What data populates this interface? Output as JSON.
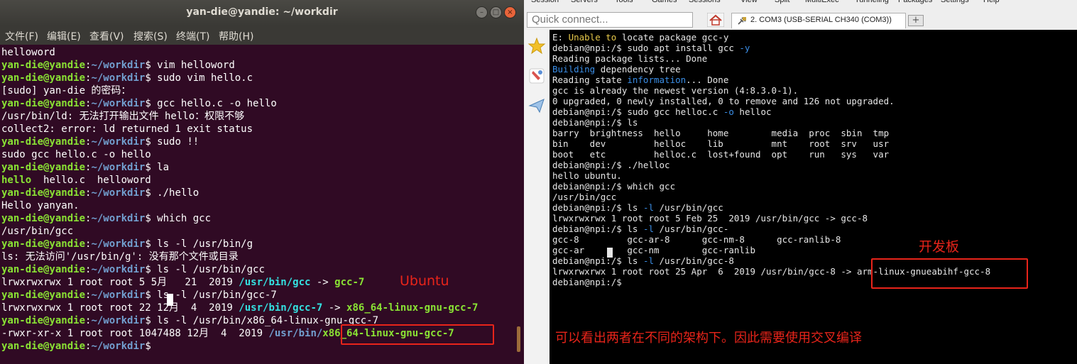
{
  "ubuntu": {
    "title": "yan-die@yandie: ~/workdir",
    "menu": [
      "文件(F)",
      "编辑(E)",
      "查看(V)",
      "搜索(S)",
      "终端(T)",
      "帮助(H)"
    ],
    "prompt_user": "yan-die@yandie",
    "prompt_path": "~/workdir",
    "lines": [
      {
        "t": "out",
        "text": "helloword"
      },
      {
        "t": "cmd",
        "text": "vim helloword"
      },
      {
        "t": "cmd",
        "text": "sudo vim hello.c"
      },
      {
        "t": "out",
        "text": "[sudo] yan-die 的密码："
      },
      {
        "t": "cmd",
        "text": "gcc hello.c -o hello"
      },
      {
        "t": "out",
        "text": "/usr/bin/ld: 无法打开输出文件 hello：权限不够"
      },
      {
        "t": "out",
        "text": "collect2: error: ld returned 1 exit status"
      },
      {
        "t": "cmd",
        "text": "sudo !!"
      },
      {
        "t": "out",
        "text": "sudo gcc hello.c -o hello"
      },
      {
        "t": "cmd",
        "text": "la"
      },
      {
        "t": "ls",
        "exe": "hello",
        "rest": "  hello.c  helloword"
      },
      {
        "t": "cmd",
        "text": "./hello"
      },
      {
        "t": "out",
        "text": "Hello yanyan."
      },
      {
        "t": "cmd",
        "text": "which gcc"
      },
      {
        "t": "out",
        "text": "/usr/bin/gcc"
      },
      {
        "t": "cmd",
        "text": "ls -l /usr/bin/g"
      },
      {
        "t": "out",
        "text": "ls: 无法访问'/usr/bin/g': 没有那个文件或目录"
      },
      {
        "t": "cmd",
        "text": "ls -l /usr/bin/gcc"
      },
      {
        "t": "link",
        "pre": "lrwxrwxrwx 1 root root 5 5月   21  2019 ",
        "link": "/usr/bin/gcc",
        "arrow": " -> ",
        "target": "gcc-7"
      },
      {
        "t": "cmd",
        "text": "ls -l /usr/bin/gcc-7"
      },
      {
        "t": "link",
        "pre": "lrwxrwxrwx 1 root root 22 12月  4  2019 ",
        "link": "/usr/bin/gcc-7",
        "arrow": " -> ",
        "target": "x86_64-linux-gnu-gcc-7"
      },
      {
        "t": "cmd",
        "text": "ls -l /usr/bin/x86_64-linux-gnu-gcc-7"
      },
      {
        "t": "exe",
        "pre": "-rwxr-xr-x 1 root root 1047488 12月  4  2019 ",
        "path": "/usr/bin/",
        "file": "x86_64-linux-gnu-gcc-7"
      },
      {
        "t": "cmd",
        "text": ""
      }
    ],
    "annotation": "Ubuntu"
  },
  "serial": {
    "top_menu": [
      "Session",
      "Servers",
      "Tools",
      "Games",
      "Sessions",
      "View",
      "Split",
      "MultiExec",
      "Tunneling",
      "Packages",
      "Settings",
      "Help"
    ],
    "quick_connect_placeholder": "Quick connect...",
    "tab_label": "2. COM3  (USB-SERIAL CH340 (COM3))",
    "new_tab": "+",
    "lines": [
      [
        [
          "E: ",
          ""
        ],
        [
          "Unable to",
          "y"
        ],
        [
          " locate package gcc-y",
          ""
        ]
      ],
      [
        [
          "debian@npi:/$ sudo apt install gcc ",
          ""
        ],
        [
          "-y",
          "b"
        ]
      ],
      [
        [
          "Reading package lists... Done",
          ""
        ]
      ],
      [
        [
          "Building",
          "b"
        ],
        [
          " dependency tree",
          ""
        ]
      ],
      [
        [
          "Reading state ",
          ""
        ],
        [
          "information",
          "b"
        ],
        [
          "... Done",
          ""
        ]
      ],
      [
        [
          "gcc is already the newest version (4:8.3.0-1).",
          ""
        ]
      ],
      [
        [
          "0 upgraded, 0 newly installed, 0 to remove and 126 not upgraded.",
          ""
        ]
      ],
      [
        [
          "debian@npi:/$ sudo gcc helloc.c ",
          ""
        ],
        [
          "-o",
          "b"
        ],
        [
          " helloc",
          ""
        ]
      ],
      [
        [
          "debian@npi:/$ ls",
          ""
        ]
      ],
      [
        [
          "barry  brightness  hello     home        media  proc  sbin  tmp",
          ""
        ]
      ],
      [
        [
          "bin    dev         helloc    lib         mnt    root  srv   usr",
          ""
        ]
      ],
      [
        [
          "boot   etc         helloc.c  lost+found  opt    run   sys   var",
          ""
        ]
      ],
      [
        [
          "debian@npi:/$ ./helloc",
          ""
        ]
      ],
      [
        [
          "hello ubuntu.",
          ""
        ]
      ],
      [
        [
          "debian@npi:/$ which gcc",
          ""
        ]
      ],
      [
        [
          "/usr/bin/gcc",
          ""
        ]
      ],
      [
        [
          "debian@npi:/$ ls ",
          ""
        ],
        [
          "-l",
          "b"
        ],
        [
          " /usr/bin/gcc",
          ""
        ]
      ],
      [
        [
          "lrwxrwxrwx 1 root root 5 Feb 25  2019 /usr/bin/gcc -> gcc-8",
          ""
        ]
      ],
      [
        [
          "debian@npi:/$ ls ",
          ""
        ],
        [
          "-l",
          "b"
        ],
        [
          " /usr/bin/gcc-",
          ""
        ]
      ],
      [
        [
          "gcc-8         gcc-ar-8      gcc-nm-8      gcc-ranlib-8",
          ""
        ]
      ],
      [
        [
          "gcc-ar        gcc-nm        gcc-ranlib",
          ""
        ]
      ],
      [
        [
          "debian@npi:/$ ls ",
          ""
        ],
        [
          "-l",
          "b"
        ],
        [
          " /usr/bin/gcc-8",
          ""
        ]
      ],
      [
        [
          "lrwxrwxrwx 1 root root 25 Apr  6  2019 /usr/bin/gcc-8 -> arm-linux-gnueabihf-gcc-8",
          ""
        ]
      ],
      [
        [
          "debian@npi:/$ ",
          ""
        ]
      ]
    ],
    "annotation_board": "开发板",
    "annotation_note": "可以看出两者在不同的架构下。因此需要使用交叉编译"
  }
}
